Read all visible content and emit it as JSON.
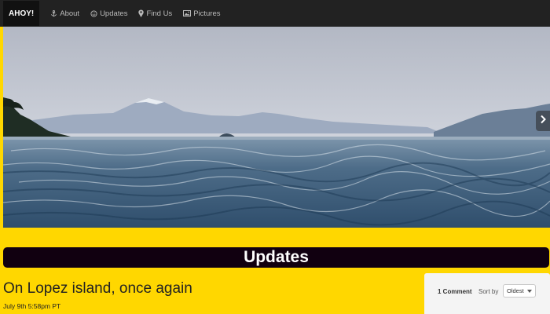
{
  "nav": {
    "brand": "AHOY!",
    "items": [
      {
        "label": "About",
        "icon": "anchor-icon"
      },
      {
        "label": "Updates",
        "icon": "smiley-icon"
      },
      {
        "label": "Find Us",
        "icon": "map-marker-icon"
      },
      {
        "label": "Pictures",
        "icon": "picture-icon"
      }
    ]
  },
  "carousel": {
    "next_icon": "chevron-right-icon"
  },
  "section": {
    "heading": "Updates"
  },
  "post": {
    "title": "On Lopez island, once again",
    "date": "July 9th 5:58pm PT"
  },
  "comments": {
    "count_label": "1 Comment",
    "sort_label": "Sort by",
    "sort_selected": "Oldest"
  },
  "colors": {
    "page_background": "#ffd700",
    "navbar": "#222222",
    "banner": "#110010"
  }
}
